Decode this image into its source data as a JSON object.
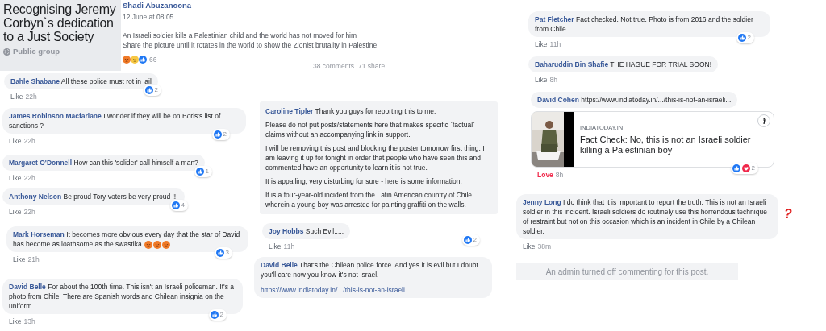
{
  "group": {
    "title": "Recognising Jeremy Corbyn`s dedication to a Just Society",
    "privacy": "Public group"
  },
  "post": {
    "author": "Shadi Abuzanoona",
    "time": "12 June at 08:05",
    "text_lines": [
      "An Israeli soldier kills a Palestinian child and the world has not moved for him",
      "Share the picture until it rotates in the world to show the Zionist brutality in Palestine"
    ],
    "reactions": [
      {
        "kind": "angry"
      },
      {
        "kind": "sad"
      },
      {
        "kind": "like"
      }
    ],
    "reaction_count": "66",
    "comments_count": "38 comments",
    "shares_count": "71 share"
  },
  "comments": [
    {
      "author": "Bahle Shabane",
      "text": "All these police must rot in jail",
      "action": "Like",
      "reacted": false,
      "time": "22h",
      "reactions": [
        {
          "kind": "like"
        }
      ],
      "reaction_count": "2"
    },
    {
      "author": "James Robinson Macfarlane",
      "text": "I wonder if they will be on Boris's list of sanctions ?",
      "action": "Like",
      "reacted": false,
      "time": "22h",
      "reactions": [
        {
          "kind": "like"
        }
      ],
      "reaction_count": "2"
    },
    {
      "author": "Margaret O'Donnell",
      "text": "How can this 'solider' call himself a man?",
      "action": "Like",
      "reacted": false,
      "time": "22h",
      "reactions": [
        {
          "kind": "like"
        }
      ],
      "reaction_count": "1"
    },
    {
      "author": "Anthony Nelson",
      "text": "Be proud Tory voters be very proud !!!",
      "action": "Like",
      "reacted": false,
      "time": "22h",
      "reactions": [
        {
          "kind": "like"
        }
      ],
      "reaction_count": "4"
    },
    {
      "author": "Mark Horseman",
      "text": "It becomes more obvious every day that the star of David has become as loathsome as the swastika",
      "emojis": [
        {
          "kind": "angry"
        },
        {
          "kind": "angry"
        },
        {
          "kind": "angry"
        }
      ],
      "action": "Like",
      "reacted": false,
      "time": "21h",
      "reactions": [
        {
          "kind": "like"
        }
      ],
      "reaction_count": "3"
    },
    {
      "author": "David Belle",
      "text": "For about the 100th time. This isn't an Israeli policeman. It's a photo from Chile. There are Spanish words and Chilean insignia on the uniform.",
      "action": "Like",
      "reacted": false,
      "time": "13h",
      "reactions": [
        {
          "kind": "like"
        }
      ],
      "reaction_count": "2"
    },
    {
      "author": "Caroline Tipler",
      "text": "Thank you guys for reporting this to me.",
      "paragraphs": [
        "Please do not put posts/statements here that makes specific `factual` claims without an accompanying link in support.",
        "I will be removing this post and blocking the poster tomorrow first thing. I am leaving it up for tonight in order that people who have seen this and commented have an opportunity to learn it is not true.",
        "It is appalling, very disturbing for sure - here is some information:",
        "It is a four-year-old incident from the Latin American country of Chile wherein a young boy was arrested for painting graffiti on the walls."
      ]
    },
    {
      "author": "Joy Hobbs",
      "text": "Such Evil.....",
      "action": "Like",
      "reacted": false,
      "time": "11h",
      "reactions": [
        {
          "kind": "like"
        }
      ],
      "reaction_count": "2"
    },
    {
      "author": "David Belle",
      "text": "That's the Chilean police force. And yes it is evil but I doubt you'll care now you know it's not Israel.",
      "link": "https://www.indiatoday.in/.../this-is-not-an-israeli..."
    },
    {
      "author": "Pat Fletcher",
      "text": "Fact checked. Not true. Photo is from 2016 and the soldier from Chile.",
      "action": "Like",
      "reacted": false,
      "time": "11h",
      "reactions": [
        {
          "kind": "like"
        }
      ],
      "reaction_count": "2"
    },
    {
      "author": "Baharuddin Bin Shafie",
      "text": "THE HAGUE FOR TRIAL SOON!",
      "action": "Like",
      "reacted": false,
      "time": "8h"
    },
    {
      "author": "David Cohen",
      "text": "https://www.indiatoday.in/.../this-is-not-an-israeli...",
      "preview": {
        "kind": "picture",
        "domain": "INDIATODAY.IN",
        "title": "Fact Check: No, this is not an Israeli soldier killing a Palestinian boy"
      },
      "action": "Love",
      "reacted": true,
      "time": "8h",
      "reactions": [
        {
          "kind": "like"
        },
        {
          "kind": "love"
        }
      ],
      "reaction_count": "2"
    },
    {
      "author": "Jenny Long",
      "text": "I do think that it is important to report the truth. This is not an Israeli soldier in this incident. Israeli soldiers do routinely use this horrendous technique of restraint but not on this occasion which is an incident in Chile by a Chilean soldier.",
      "action": "Like",
      "reacted": false,
      "time": "38m"
    }
  ],
  "admin_notice": "An admin turned off commenting for this post.",
  "annotation": "?"
}
